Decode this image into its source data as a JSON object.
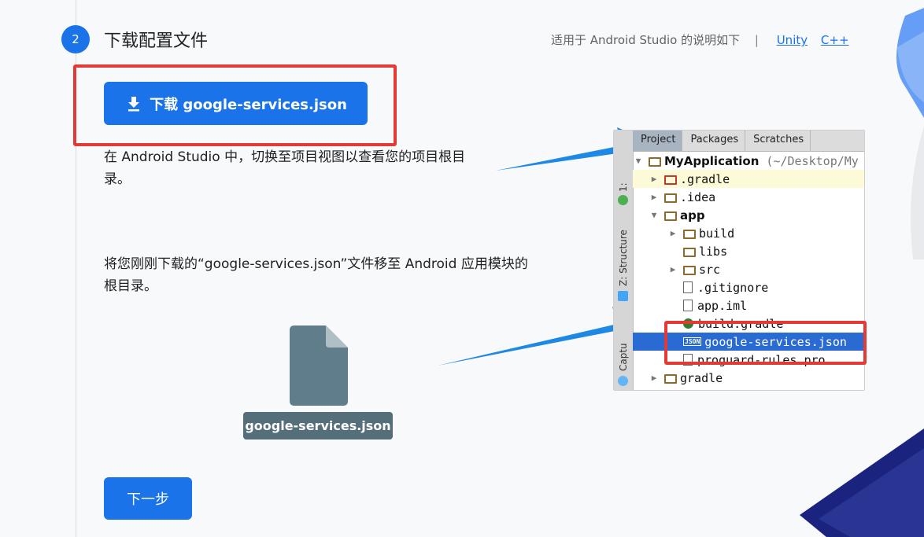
{
  "step": {
    "number": "2",
    "title": "下载配置文件",
    "platform_note": "适用于 Android Studio 的说明如下",
    "separator": "|",
    "links": [
      "Unity",
      "C++"
    ]
  },
  "download_button": {
    "label": "下载 google-services.json"
  },
  "description_1": "在 Android Studio 中，切换至项目视图以查看您的项目根目录。",
  "description_2": "将您刚刚下载的“google-services.json”文件移至 Android 应用模块的根目录。",
  "file_label": "google-services.json",
  "next_button": {
    "label": "下一步"
  },
  "android_studio": {
    "tabs": [
      "Project",
      "Packages",
      "Scratches"
    ],
    "side_labels": [
      "1:",
      "Z: Structure",
      "Captu"
    ],
    "tree": {
      "root": "MyApplication",
      "root_path": "(~/Desktop/My",
      "items": [
        ".gradle",
        ".idea",
        "app",
        "build",
        "libs",
        "src",
        ".gitignore",
        "app.iml",
        "build.gradle",
        "google-services.json",
        "proguard-rules.pro",
        "gradle"
      ]
    }
  },
  "colors": {
    "accent": "#1a73e8",
    "highlight": "#e53935",
    "file": "#607d8b"
  }
}
